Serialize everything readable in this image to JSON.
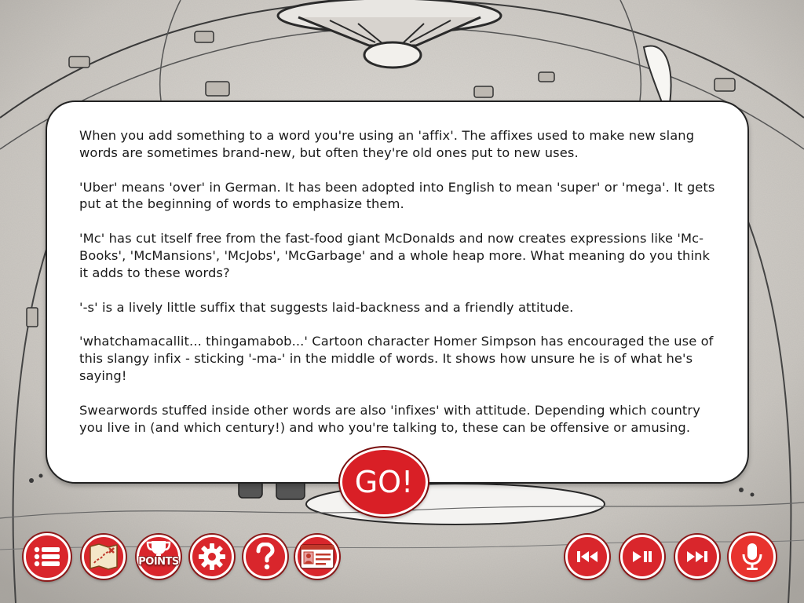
{
  "info_panel": {
    "paragraphs": [
      "When you add something to a word you're using an 'affix'.  The affixes used to make new slang words are sometimes brand-new, but often they're old ones put to new uses.",
      "'Uber' means 'over' in German.  It has been adopted into English to mean 'super' or 'mega'.  It gets put at the beginning of words to emphasize them.",
      "'Mc' has cut itself free from the fast-food giant McDonalds and now creates expressions like 'Mc-Books', 'McMansions', 'McJobs', 'McGarbage' and a whole heap more.  What meaning do you think it adds to these words?",
      "'-s' is a lively little suffix that suggests laid-backness and a friendly attitude.",
      "'whatchamacallit... thingamabob...' Cartoon character Homer Simpson has encouraged the use of this slangy infix - sticking '-ma-' in the middle of words.  It shows how unsure he is of what he's saying!",
      "Swearwords stuffed inside other words are also 'infixes' with attitude.  Depending which country you live in (and which century!) and who you're talking to, these can be offensive or amusing."
    ]
  },
  "go_button": {
    "label": "GO!"
  },
  "toolbar": {
    "left": [
      {
        "name": "menu-list-button",
        "icon": "list-icon"
      },
      {
        "name": "map-button",
        "icon": "treasure-map-icon"
      },
      {
        "name": "points-button",
        "icon": "trophy-icon",
        "label": "POINTS"
      },
      {
        "name": "settings-button",
        "icon": "gear-icon"
      },
      {
        "name": "help-button",
        "icon": "question-icon"
      },
      {
        "name": "profile-card-button",
        "icon": "id-card-icon"
      }
    ],
    "right": [
      {
        "name": "previous-button",
        "icon": "skip-back-icon"
      },
      {
        "name": "play-pause-button",
        "icon": "play-pause-icon"
      },
      {
        "name": "next-button",
        "icon": "skip-forward-icon"
      },
      {
        "name": "microphone-button",
        "icon": "microphone-icon"
      }
    ]
  },
  "colors": {
    "accent_red": "#d9262c",
    "panel_white": "#ffffff",
    "background_gray": "#cfcbc6"
  }
}
